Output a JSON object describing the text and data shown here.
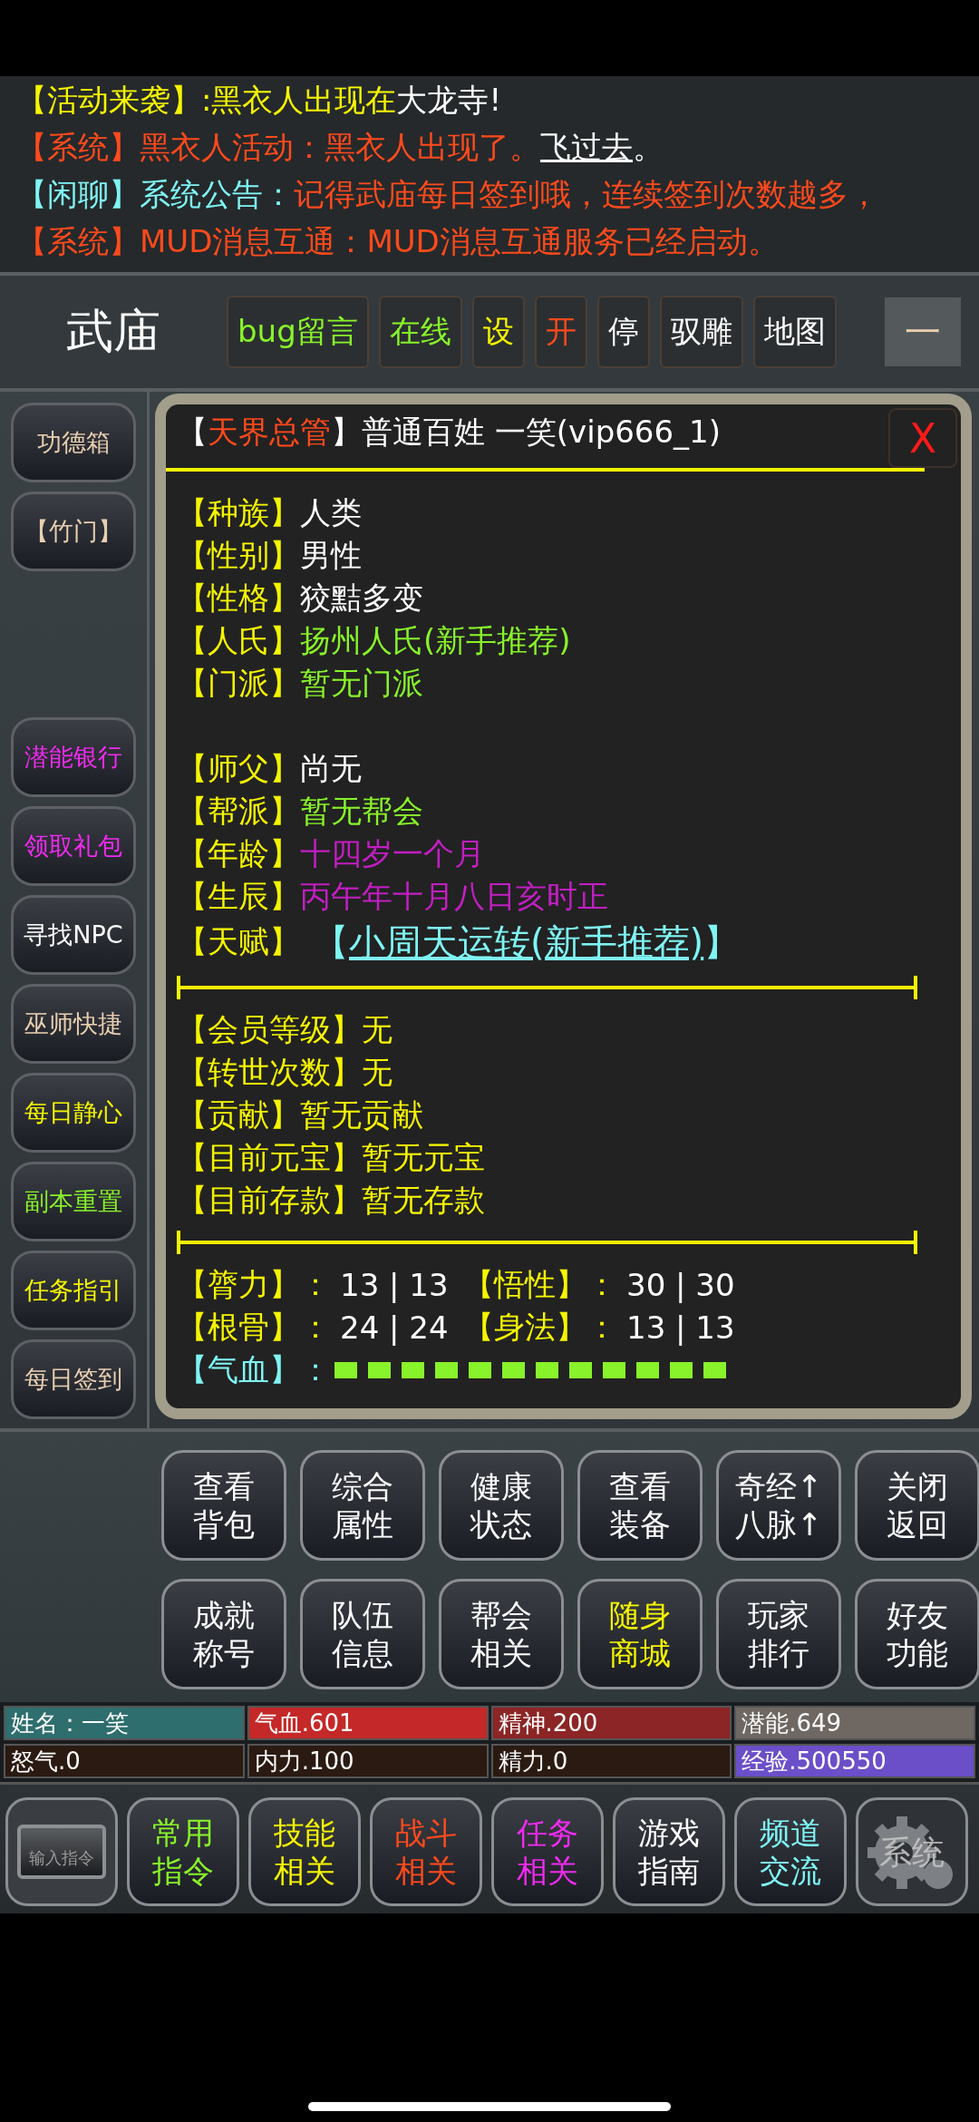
{
  "messages": [
    {
      "segments": [
        {
          "text": "【活动来袭】:黑衣人出现在",
          "color": "#f5f500"
        },
        {
          "text": "大龙寺!",
          "color": "#ffffff"
        }
      ]
    },
    {
      "segments": [
        {
          "text": "【系统】黑衣人活动：黑衣人出现了。",
          "color": "#ff4a1c"
        },
        {
          "text": "飞过去",
          "color": "#ffffff",
          "kind": "link"
        },
        {
          "text": "。",
          "color": "#ffffff"
        }
      ]
    },
    {
      "segments": [
        {
          "text": "【闲聊】",
          "color": "#7ff4f4"
        },
        {
          "text": "系统公告：",
          "color": "#7ff4f4"
        },
        {
          "text": "记得武庙每日签到哦，连续签到次数越多，",
          "color": "#ff4a1c"
        }
      ]
    },
    {
      "segments": [
        {
          "text": "【系统】MUD消息互通：MUD消息互通服务已经启动。",
          "color": "#ff4a1c"
        }
      ]
    }
  ],
  "header": {
    "location": "武庙",
    "buttons": [
      {
        "label": "bug留言",
        "color": "#88f22a"
      },
      {
        "label": "在线",
        "color": "#88f22a"
      },
      {
        "label": "设",
        "color": "#f5f500"
      },
      {
        "label": "开",
        "color": "#ff4a1c"
      },
      {
        "label": "停",
        "color": "#ffffff"
      },
      {
        "label": "驭雕",
        "color": "#ffffff"
      },
      {
        "label": "地图",
        "color": "#ffffff"
      }
    ],
    "minimize": "一"
  },
  "sidebar": {
    "top": [
      {
        "label": "功德箱",
        "color": "#e8cfb0"
      },
      {
        "label": "【竹门】",
        "color": "#e8cfb0"
      }
    ],
    "bottom": [
      {
        "label": "潜能银行",
        "color": "#f02af0"
      },
      {
        "label": "领取礼包",
        "color": "#f02af0"
      },
      {
        "label": "寻找NPC",
        "color": "#ffffff"
      },
      {
        "label": "巫师快捷",
        "color": "#e8cfb0"
      },
      {
        "label": "每日静心",
        "color": "#f5f500"
      },
      {
        "label": "副本重置",
        "color": "#88f22a"
      },
      {
        "label": "任务指引",
        "color": "#f5f500"
      },
      {
        "label": "每日签到",
        "color": "#e8cfb0"
      }
    ]
  },
  "popup": {
    "title": [
      {
        "text": "【",
        "color": "#ffffff"
      },
      {
        "text": "天界总管",
        "color": "#ff4a1c"
      },
      {
        "text": "】普通百姓 一笑(vip666_1)",
        "color": "#ffffff"
      }
    ],
    "close": "X",
    "rows": [
      {
        "kind": "field",
        "label": "【种族】",
        "value": "人类",
        "color": "#ffffff"
      },
      {
        "kind": "field",
        "label": "【性别】",
        "value": "男性",
        "color": "#ffffff"
      },
      {
        "kind": "field",
        "label": "【性格】",
        "value": "狡黠多变",
        "color": "#ffffff"
      },
      {
        "kind": "field",
        "label": "【人氏】",
        "value": "扬州人氏(新手推荐)",
        "color": "#88f22a"
      },
      {
        "kind": "field",
        "label": "【门派】",
        "value": "暂无门派",
        "color": "#88f22a"
      },
      {
        "kind": "blank"
      },
      {
        "kind": "field",
        "label": "【师父】",
        "value": "尚无",
        "color": "#ffffff"
      },
      {
        "kind": "field",
        "label": "【帮派】",
        "value": "暂无帮会",
        "color": "#88f22a"
      },
      {
        "kind": "field",
        "label": "【年龄】",
        "value": "十四岁一个月",
        "color": "#c21ec2"
      },
      {
        "kind": "field",
        "label": "【生辰】",
        "value": "丙午年十月八日亥时正",
        "color": "#c21ec2"
      },
      {
        "kind": "link",
        "label": "【天赋】",
        "open": "【",
        "value": "小周天运转(新手推荐)",
        "close": "】",
        "color": "#7ff4f4"
      },
      {
        "kind": "divider"
      },
      {
        "kind": "field",
        "label": "【会员等级】",
        "value": "无",
        "color": "#f5f500"
      },
      {
        "kind": "field",
        "label": "【转世次数】",
        "value": "无",
        "color": "#f5f500"
      },
      {
        "kind": "field",
        "label": "【贡献】",
        "value": "暂无贡献",
        "color": "#f5f500"
      },
      {
        "kind": "field",
        "label": "【目前元宝】",
        "value": "暂无元宝",
        "color": "#f5f500"
      },
      {
        "kind": "field",
        "label": "【目前存款】",
        "value": "暂无存款",
        "color": "#f5f500"
      },
      {
        "kind": "divider"
      },
      {
        "kind": "stats",
        "items": [
          {
            "label": "【膂力】：",
            "value": "13 | 13"
          },
          {
            "label": "【悟性】：",
            "value": "30 | 30"
          }
        ]
      },
      {
        "kind": "stats",
        "items": [
          {
            "label": "【根骨】：",
            "value": "24 | 24"
          },
          {
            "label": "【身法】：",
            "value": "13 | 13"
          }
        ]
      },
      {
        "kind": "meter",
        "label": "【气血】："
      }
    ]
  },
  "actions": [
    {
      "label": "查看背包",
      "color": "#ffffff"
    },
    {
      "label": "综合属性",
      "color": "#ffffff"
    },
    {
      "label": "健康状态",
      "color": "#ffffff"
    },
    {
      "label": "查看装备",
      "color": "#ffffff"
    },
    {
      "label": "奇经↑八脉↑",
      "color": "#ffffff"
    },
    {
      "label": "关闭返回",
      "color": "#ffffff"
    },
    {
      "label": "成就称号",
      "color": "#ffffff"
    },
    {
      "label": "队伍信息",
      "color": "#ffffff"
    },
    {
      "label": "帮会相关",
      "color": "#ffffff"
    },
    {
      "label": "随身商城",
      "color": "#f5f500"
    },
    {
      "label": "玩家排行",
      "color": "#ffffff"
    },
    {
      "label": "好友功能",
      "color": "#ffffff"
    }
  ],
  "status": [
    {
      "text": "姓名：一笑",
      "color": "#2f6e6e"
    },
    {
      "text": "气血.601",
      "color": "#c42828"
    },
    {
      "text": "精神.200",
      "color": "#8c2525"
    },
    {
      "text": "潜能.649",
      "color": "#6e6762"
    },
    {
      "text": "怒气.0",
      "color": "#2a1a12"
    },
    {
      "text": "内力.100",
      "color": "#2a1a12"
    },
    {
      "text": "精力.0",
      "color": "#2a1a12"
    },
    {
      "text": "经验.500550",
      "color": "#6a4fc8"
    }
  ],
  "nav": [
    {
      "kind": "input",
      "label": "输入指令"
    },
    {
      "kind": "text",
      "label": "常用指令",
      "color": "#88f22a"
    },
    {
      "kind": "text",
      "label": "技能相关",
      "color": "#f5f500"
    },
    {
      "kind": "text",
      "label": "战斗相关",
      "color": "#ff4a1c"
    },
    {
      "kind": "text",
      "label": "任务相关",
      "color": "#f02af0"
    },
    {
      "kind": "text",
      "label": "游戏指南",
      "color": "#ffffff"
    },
    {
      "kind": "text",
      "label": "频道交流",
      "color": "#7ff4f4"
    },
    {
      "kind": "system",
      "label": "系统"
    }
  ]
}
